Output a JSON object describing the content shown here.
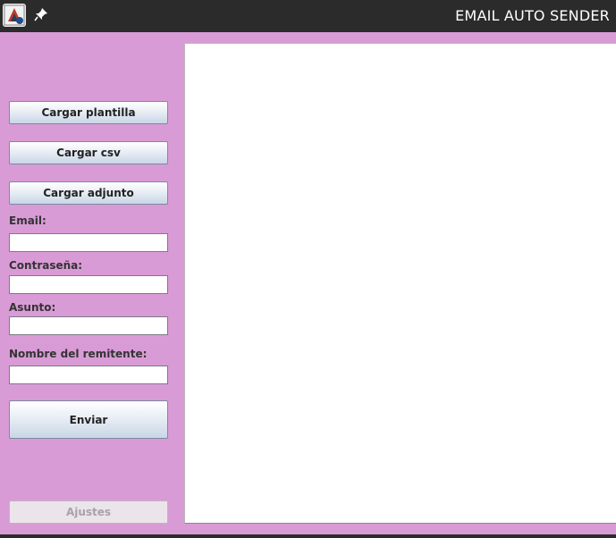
{
  "window": {
    "title": "EMAIL AUTO SENDER"
  },
  "sidebar": {
    "load_template_label": "Cargar plantilla",
    "load_csv_label": "Cargar csv",
    "load_attachment_label": "Cargar adjunto",
    "email_label": "Email:",
    "email_value": "",
    "password_label": "Contraseña:",
    "password_value": "",
    "subject_label": "Asunto:",
    "subject_value": "",
    "sender_name_label": "Nombre del remitente:",
    "sender_name_value": "",
    "send_label": "Enviar",
    "settings_label": "Ajustes"
  },
  "colors": {
    "sidebar_bg": "#d99bd6",
    "titlebar_bg": "#2b2b2b",
    "content_bg": "#ffffff"
  },
  "icons": {
    "app": "java-app-icon",
    "pin": "pin-icon"
  }
}
